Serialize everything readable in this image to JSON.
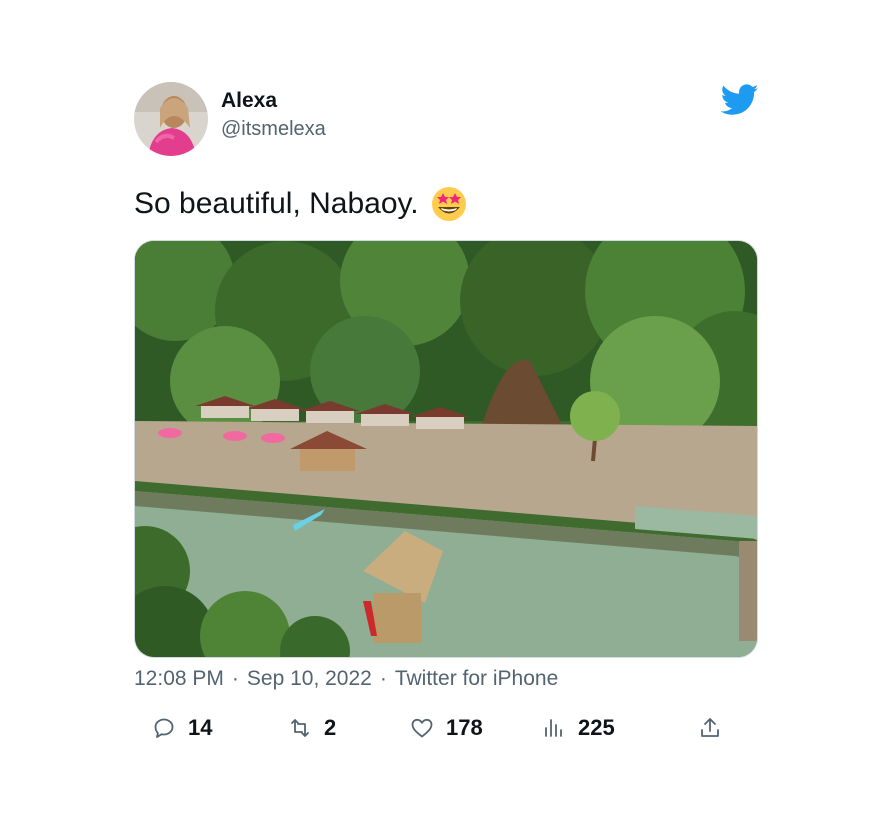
{
  "author": {
    "name": "Alexa",
    "handle": "@itsmelexa",
    "avatar_icon": "user-avatar"
  },
  "brand": {
    "icon": "twitter-bird-icon",
    "color": "#1d9bf0"
  },
  "tweet": {
    "text": "So beautiful, Nabaoy.",
    "emoji": "star-struck-emoji",
    "media_icon": "photo-resort-river"
  },
  "meta": {
    "time": "12:08 PM",
    "separator": "·",
    "date": "Sep 10, 2022",
    "source": "Twitter for iPhone"
  },
  "actions": {
    "replies": "14",
    "retweets": "2",
    "likes": "178",
    "views": "225"
  },
  "colors": {
    "text": "#0f1419",
    "secondary": "#536471",
    "accent": "#1d9bf0"
  }
}
